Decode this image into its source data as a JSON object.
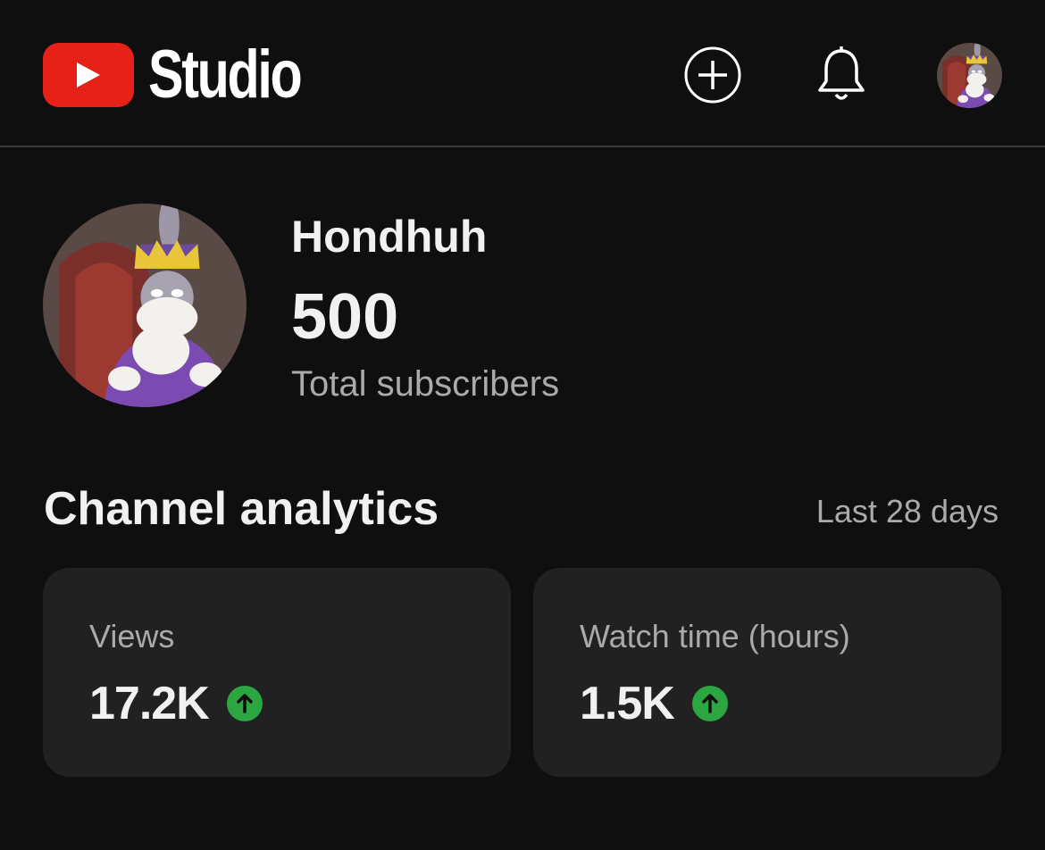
{
  "header": {
    "logo_text": "Studio",
    "brand_color": "#e62117",
    "icons": [
      "youtube-play-icon",
      "create-plus-icon",
      "bell-icon"
    ]
  },
  "channel": {
    "name": "Hondhuh",
    "subscriber_count": "500",
    "subscriber_label": "Total subscribers"
  },
  "analytics": {
    "title": "Channel analytics",
    "period": "Last 28 days",
    "cards": [
      {
        "label": "Views",
        "value": "17.2K",
        "trend": "up",
        "trend_icon": "arrow-up-icon",
        "trend_color": "#2ba640"
      },
      {
        "label": "Watch time (hours)",
        "value": "1.5K",
        "trend": "up",
        "trend_icon": "arrow-up-icon",
        "trend_color": "#2ba640"
      }
    ]
  }
}
